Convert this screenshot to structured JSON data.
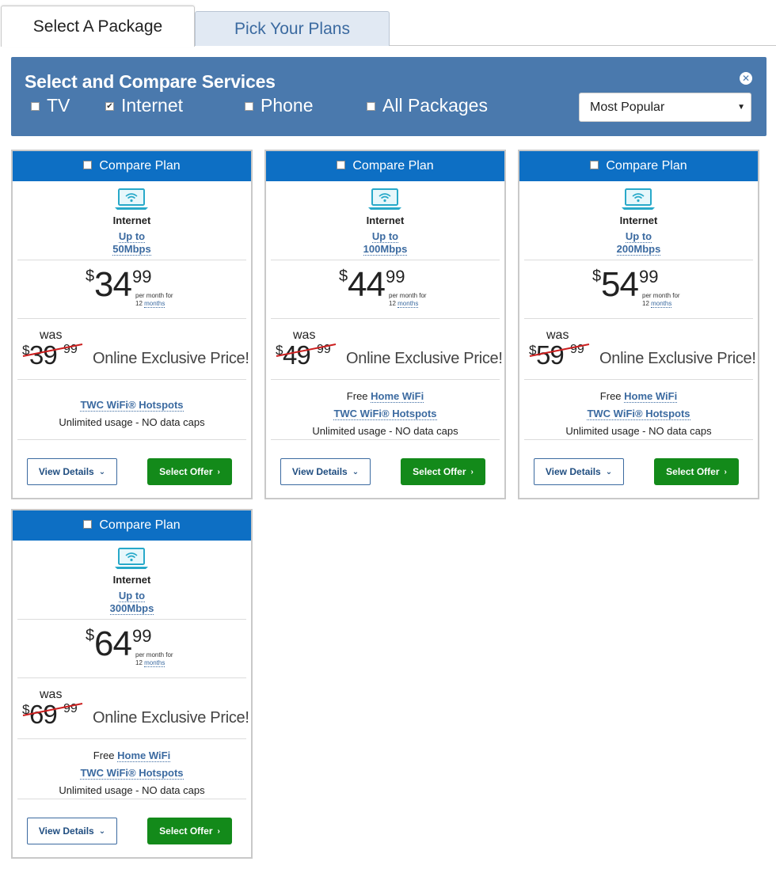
{
  "tabs": [
    {
      "label": "Select A Package"
    },
    {
      "label": "Pick Your Plans"
    }
  ],
  "filter": {
    "title": "Select and Compare Services",
    "close_glyph": "✕",
    "options": [
      {
        "label": "TV",
        "checked": false
      },
      {
        "label": "Internet",
        "checked": true
      },
      {
        "label": "Phone",
        "checked": false
      },
      {
        "label": "All Packages",
        "checked": false
      }
    ],
    "sort": {
      "selected": "Most Popular"
    }
  },
  "colors": {
    "accent": "#4a79ad",
    "card_header": "#0d6fc4",
    "select_button": "#138a1a",
    "link": "#3b6aa0",
    "strike": "#cc1f1f"
  },
  "cards": [
    {
      "compare_label": "Compare Plan",
      "service": "Internet",
      "speed_line1": "Up to",
      "speed_line2": "50Mbps",
      "price_dollar": "$",
      "price_whole": "34",
      "price_cents": "99",
      "per_month": "per month for",
      "term_num": "12",
      "term_unit": "months",
      "was_label": "was",
      "was_dollar": "$",
      "was_whole": "39",
      "was_cents": "99",
      "exclusive": "Online Exclusive Price!",
      "free_prefix": "",
      "home_wifi": "",
      "hotspots": "TWC WiFi® Hotspots",
      "usage": "Unlimited usage - NO data caps",
      "details_label": "View Details",
      "select_label": "Select Offer"
    },
    {
      "compare_label": "Compare Plan",
      "service": "Internet",
      "speed_line1": "Up to",
      "speed_line2": "100Mbps",
      "price_dollar": "$",
      "price_whole": "44",
      "price_cents": "99",
      "per_month": "per month for",
      "term_num": "12",
      "term_unit": "months",
      "was_label": "was",
      "was_dollar": "$",
      "was_whole": "49",
      "was_cents": "99",
      "exclusive": "Online Exclusive Price!",
      "free_prefix": "Free",
      "home_wifi": "Home WiFi",
      "hotspots": "TWC WiFi® Hotspots",
      "usage": "Unlimited usage - NO data caps",
      "details_label": "View Details",
      "select_label": "Select Offer"
    },
    {
      "compare_label": "Compare Plan",
      "service": "Internet",
      "speed_line1": "Up to",
      "speed_line2": "200Mbps",
      "price_dollar": "$",
      "price_whole": "54",
      "price_cents": "99",
      "per_month": "per month for",
      "term_num": "12",
      "term_unit": "months",
      "was_label": "was",
      "was_dollar": "$",
      "was_whole": "59",
      "was_cents": "99",
      "exclusive": "Online Exclusive Price!",
      "free_prefix": "Free",
      "home_wifi": "Home WiFi",
      "hotspots": "TWC WiFi® Hotspots",
      "usage": "Unlimited usage - NO data caps",
      "details_label": "View Details",
      "select_label": "Select Offer"
    },
    {
      "compare_label": "Compare Plan",
      "service": "Internet",
      "speed_line1": "Up to",
      "speed_line2": "300Mbps",
      "price_dollar": "$",
      "price_whole": "64",
      "price_cents": "99",
      "per_month": "per month for",
      "term_num": "12",
      "term_unit": "months",
      "was_label": "was",
      "was_dollar": "$",
      "was_whole": "69",
      "was_cents": "99",
      "exclusive": "Online Exclusive Price!",
      "free_prefix": "Free",
      "home_wifi": "Home WiFi",
      "hotspots": "TWC WiFi® Hotspots",
      "usage": "Unlimited usage - NO data caps",
      "details_label": "View Details",
      "select_label": "Select Offer"
    }
  ]
}
